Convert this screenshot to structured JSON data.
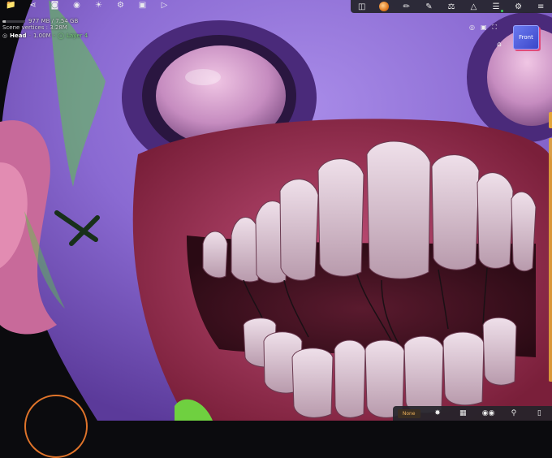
{
  "toolbar_left": {
    "icons": [
      "folder-icon",
      "share-icon",
      "head-icon",
      "sphere-icon",
      "sun-icon",
      "settings-dial-icon",
      "image-icon",
      "video-icon"
    ]
  },
  "toolbar_right": {
    "icons": [
      "stamp-icon",
      "brush-swatch",
      "brush-icon",
      "paint-icon",
      "lab-icon",
      "symmetry-icon",
      "layers-icon",
      "gear-icon",
      "sliders-icon"
    ]
  },
  "info": {
    "memory": "977 MB / 7.54 GB",
    "memory_fraction": 0.13,
    "scene_vertices": "Scene vertices : 3.28M",
    "object_name": "Head",
    "object_vertices": "1.00M",
    "layer": "Layer 4"
  },
  "viewcube": {
    "label": "Front"
  },
  "bottom_bar": {
    "none_label": "None"
  },
  "colors": {
    "accent_orange": "#e0742a",
    "toolbar_bg": "#24242a",
    "layer_green": "#7ad07a",
    "viewcube_blue": "#4b56d9"
  }
}
